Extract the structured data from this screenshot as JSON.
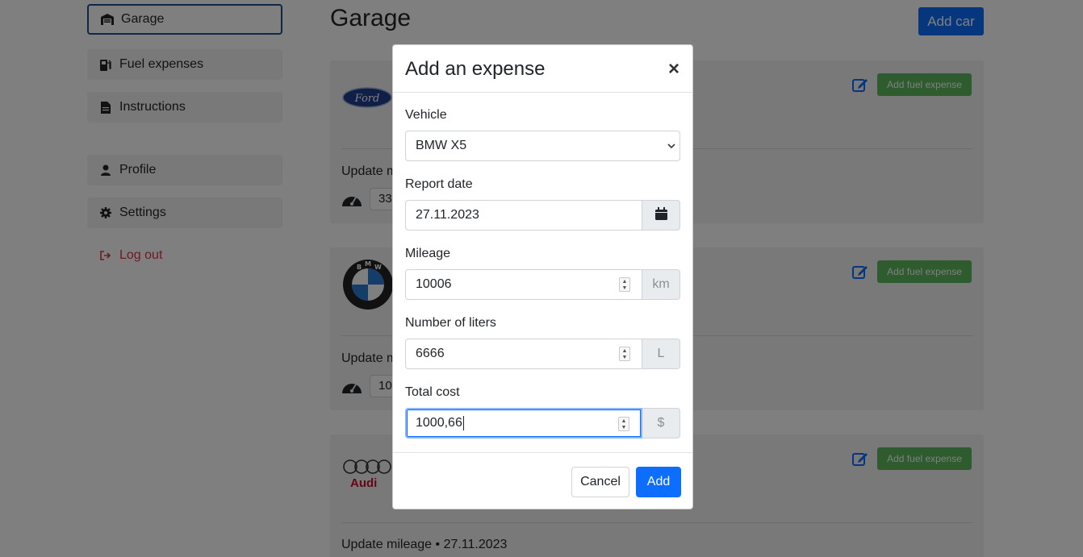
{
  "sidebar": {
    "items": [
      {
        "label": "Garage",
        "icon": "garage-icon"
      },
      {
        "label": "Fuel expenses",
        "icon": "fuel-pump-icon"
      },
      {
        "label": "Instructions",
        "icon": "document-icon"
      },
      {
        "label": "Profile",
        "icon": "user-icon"
      },
      {
        "label": "Settings",
        "icon": "gear-icon"
      },
      {
        "label": "Log out",
        "icon": "logout-icon"
      }
    ]
  },
  "main": {
    "title": "Garage",
    "add_car_label": "Add car",
    "cards": [
      {
        "brand": "Ford",
        "fuel_button": "Add fuel expense",
        "update_text": "Update m",
        "mileage_partial": "33"
      },
      {
        "brand": "BMW",
        "fuel_button": "Add fuel expense",
        "update_text": "Update m",
        "mileage_partial": "10"
      },
      {
        "brand": "Audi",
        "fuel_button": "Add fuel expense",
        "update_text": "Update mileage • 27.11.2023"
      }
    ]
  },
  "modal": {
    "title": "Add an expense",
    "close": "×",
    "vehicle": {
      "label": "Vehicle",
      "value": "BMW X5"
    },
    "report_date": {
      "label": "Report date",
      "value": "27.11.2023"
    },
    "mileage": {
      "label": "Mileage",
      "value": "10006",
      "unit": "km"
    },
    "liters": {
      "label": "Number of liters",
      "value": "6666",
      "unit": "L"
    },
    "total_cost": {
      "label": "Total cost",
      "value": "1000,66",
      "unit": "$"
    },
    "cancel_label": "Cancel",
    "add_label": "Add"
  },
  "colors": {
    "primary": "#0d6efd",
    "success": "#5cb85c",
    "danger": "#dc3545",
    "active_border": "#1c4f8c"
  }
}
